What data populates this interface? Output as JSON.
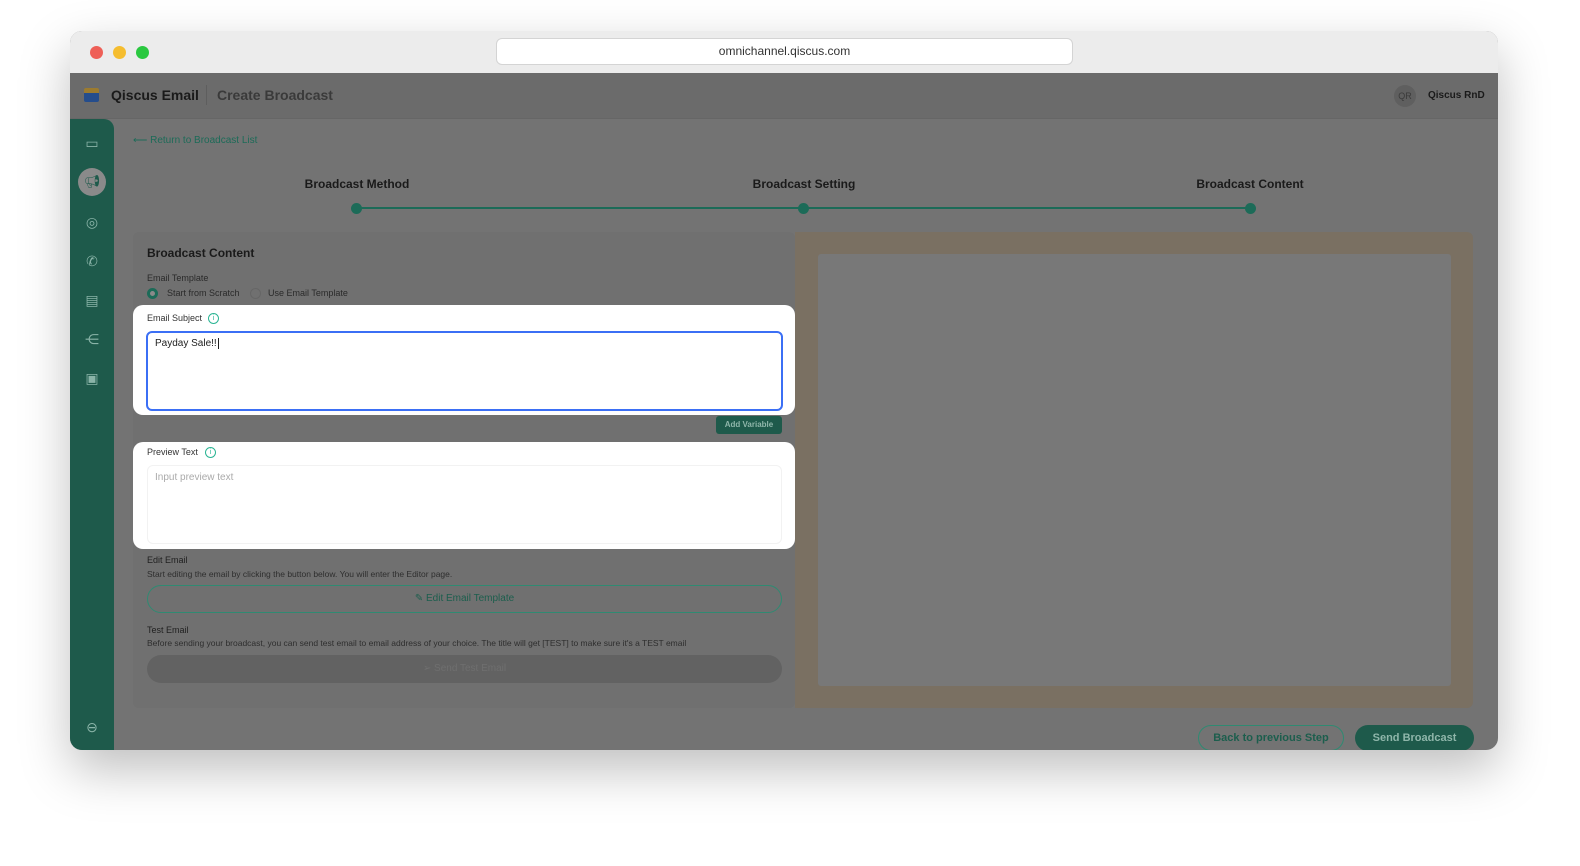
{
  "browser": {
    "url": "omnichannel.qiscus.com"
  },
  "header": {
    "app_name": "Qiscus Email",
    "page_title": "Create Broadcast",
    "avatar_initials": "QR",
    "user_name": "Qiscus RnD"
  },
  "nav": {
    "back_link": "Return to Broadcast List"
  },
  "steps": [
    {
      "label": "Broadcast Method"
    },
    {
      "label": "Broadcast Setting"
    },
    {
      "label": "Broadcast Content"
    }
  ],
  "form": {
    "title": "Broadcast Content",
    "template_label": "Email Template",
    "template_options": [
      "Start from Scratch",
      "Use Email Template"
    ],
    "subject_label": "Email Subject",
    "subject_value": "Payday Sale!!",
    "add_variable": "Add Variable",
    "preview_label": "Preview Text",
    "preview_placeholder": "Input preview text",
    "edit_label": "Edit Email",
    "edit_desc": "Start editing the email by clicking the button below. You will enter the Editor page.",
    "edit_button": "Edit Email Template",
    "test_label": "Test Email",
    "test_desc": "Before sending your broadcast, you can send test email to email address of your choice. The title will get [TEST] to make sure it's a TEST email",
    "test_button": "Send Test Email"
  },
  "footer": {
    "back": "Back to previous Step",
    "send": "Send Broadcast"
  },
  "colors": {
    "accent": "#1c6b58",
    "focus": "#3b6ff5"
  }
}
